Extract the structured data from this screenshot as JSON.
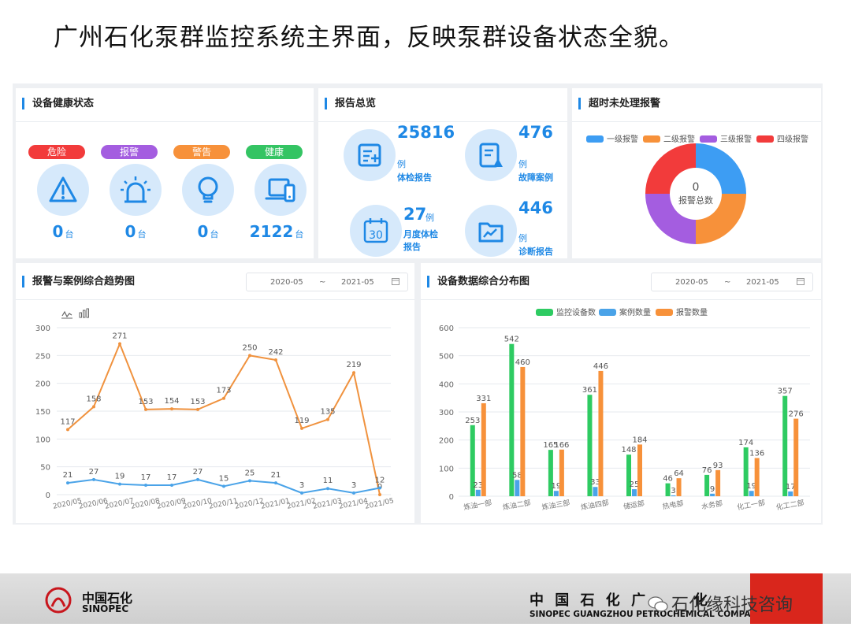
{
  "slide": {
    "title": "广州石化泵群监控系统主界面，反映泵群设备状态全貌。"
  },
  "health": {
    "title": "设备健康状态",
    "items": [
      {
        "badge": "危险",
        "value": "0",
        "unit": "台",
        "color": "#f23b3b",
        "icon": "warning-triangle-icon"
      },
      {
        "badge": "报警",
        "value": "0",
        "unit": "台",
        "color": "#a45de0",
        "icon": "alarm-siren-icon"
      },
      {
        "badge": "警告",
        "value": "0",
        "unit": "台",
        "color": "#f7913a",
        "icon": "lightbulb-icon"
      },
      {
        "badge": "健康",
        "value": "2122",
        "unit": "台",
        "color": "#34c463",
        "icon": "device-laptop-icon"
      }
    ]
  },
  "reports": {
    "title": "报告总览",
    "items": [
      {
        "value": "25816",
        "unit": "例",
        "label": "体检报告",
        "icon": "checkup-report-icon"
      },
      {
        "value": "476",
        "unit": "例",
        "label": "故障案例",
        "icon": "fault-case-icon"
      },
      {
        "value": "27",
        "unit": "例",
        "label": "月度体检报告",
        "icon": "calendar-30-icon",
        "calendar_text": "30"
      },
      {
        "value": "446",
        "unit": "例",
        "label": "诊断报告",
        "icon": "diagnosis-folder-icon"
      }
    ]
  },
  "alarms": {
    "title": "超时未处理报警",
    "legend": [
      "一级报警",
      "二级报警",
      "三级报警",
      "四级报警"
    ],
    "colors": [
      "#3d9df3",
      "#f7913a",
      "#a45de0",
      "#f23b3b"
    ],
    "center_value": "0",
    "center_label": "报警总数"
  },
  "trend": {
    "title": "报警与案例综合趋势图",
    "date_from": "2020-05",
    "date_sep": "~",
    "date_to": "2021-05"
  },
  "dist": {
    "title": "设备数据综合分布图",
    "date_from": "2020-05",
    "date_sep": "~",
    "date_to": "2021-05"
  },
  "chart_data": [
    {
      "type": "line",
      "x": [
        "2020/05",
        "2020/06",
        "2020/07",
        "2020/08",
        "2020/09",
        "2020/10",
        "2020/11",
        "2020/12",
        "2021/01",
        "2021/02",
        "2021/03",
        "2021/04",
        "2021/05"
      ],
      "series": [
        {
          "values": [
            117,
            158,
            271,
            153,
            154,
            153,
            173,
            250,
            242,
            119,
            135,
            219,
            0
          ],
          "color": "#f0923e"
        },
        {
          "values": [
            21,
            27,
            19,
            17,
            17,
            27,
            15,
            25,
            21,
            3,
            11,
            3,
            12
          ],
          "color": "#4aa3e8"
        }
      ],
      "ylim": [
        0,
        300
      ],
      "yticks": [
        0,
        50,
        100,
        150,
        200,
        250,
        300
      ],
      "grid": true
    },
    {
      "type": "bar",
      "categories": [
        "炼油一部",
        "炼油二部",
        "炼油三部",
        "炼油四部",
        "储运部",
        "热电部",
        "水务部",
        "化工一部",
        "化工二部"
      ],
      "series": [
        {
          "name": "监控设备数",
          "values": [
            253,
            542,
            165,
            361,
            148,
            46,
            76,
            174,
            357
          ],
          "color": "#2ecb62"
        },
        {
          "name": "案例数量",
          "values": [
            23,
            58,
            19,
            33,
            25,
            3,
            9,
            19,
            17
          ],
          "color": "#4aa3e8"
        },
        {
          "name": "报警数量",
          "values": [
            331,
            460,
            166,
            446,
            184,
            64,
            93,
            136,
            276
          ],
          "color": "#f7913a"
        }
      ],
      "ylim": [
        0,
        600
      ],
      "yticks": [
        0,
        100,
        200,
        300,
        400,
        500,
        600
      ],
      "legend_position": "top-center",
      "grid": true
    }
  ],
  "footer": {
    "logo_cn": "中国石化",
    "logo_en": "SINOPEC",
    "company_cn": "中 国 石 化 广",
    "company_cn_tail": "化",
    "company_en": "SINOPEC GUANGZHOU PETROCHEMICAL COMPANY",
    "watermark": "石化缘科技咨询"
  }
}
